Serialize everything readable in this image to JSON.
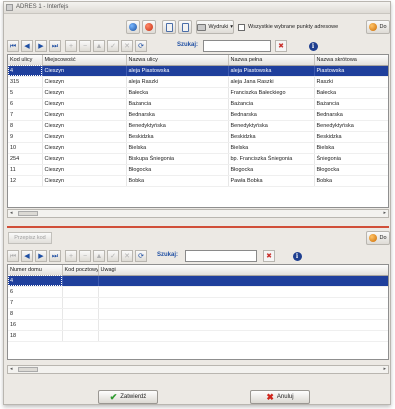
{
  "window": {
    "title": "ADRES 1 - Interfejs"
  },
  "toolbar": {
    "print_label": "Wydruki",
    "checkbox_label": "Wszystkie wybrane punkty adresowe",
    "right_label": "Do"
  },
  "search": {
    "label": "Szukaj:",
    "value": ""
  },
  "top_table": {
    "columns": [
      "Kod ulicy",
      "Miejscowość",
      "Nazwa ulicy",
      "Nazwa pełna",
      "Nazwa skrótowa"
    ],
    "rows": [
      [
        "4",
        "Cieszyn",
        "aleja Piastowska",
        "aleja Piastowska",
        "Piastowska"
      ],
      [
        "315",
        "Cieszyn",
        "aleja Raszki",
        "aleja Jana Raszki",
        "Raszki"
      ],
      [
        "5",
        "Cieszyn",
        "Bałecka",
        "Franciszka Bałeckiego",
        "Bałecka"
      ],
      [
        "6",
        "Cieszyn",
        "Bażancia",
        "Bażancia",
        "Bażancia"
      ],
      [
        "7",
        "Cieszyn",
        "Bednarska",
        "Bednarska",
        "Bednarska"
      ],
      [
        "8",
        "Cieszyn",
        "Benedyktyńska",
        "Benedyktyńska",
        "Benedyktyńska"
      ],
      [
        "9",
        "Cieszyn",
        "Beskidzka",
        "Beskidzka",
        "Beskidzka"
      ],
      [
        "10",
        "Cieszyn",
        "Bielska",
        "Bielska",
        "Bielska"
      ],
      [
        "254",
        "Cieszyn",
        "Biskupa Śniegonia",
        "bp. Franciszka Śniegonia",
        "Śniegonia"
      ],
      [
        "11",
        "Cieszyn",
        "Błogocka",
        "Błogocka",
        "Błogocka"
      ],
      [
        "12",
        "Cieszyn",
        "Bobka",
        "Pawła Bobka",
        "Bobka"
      ]
    ]
  },
  "middle": {
    "add_code_label": "Przepisz kod",
    "right_label": "Do"
  },
  "bottom_table": {
    "columns": [
      "Numer domu",
      "Kod pocztowy",
      "Uwagi"
    ],
    "rows": [
      [
        "4"
      ],
      [
        "6"
      ],
      [
        "7"
      ],
      [
        "8"
      ],
      [
        "16"
      ],
      [
        "18"
      ]
    ]
  },
  "buttons": {
    "confirm_label": "Zatwierdź",
    "cancel_label": "Anuluj"
  },
  "colors": {
    "selection": "#1f3f9c",
    "separator": "#d14f39"
  }
}
